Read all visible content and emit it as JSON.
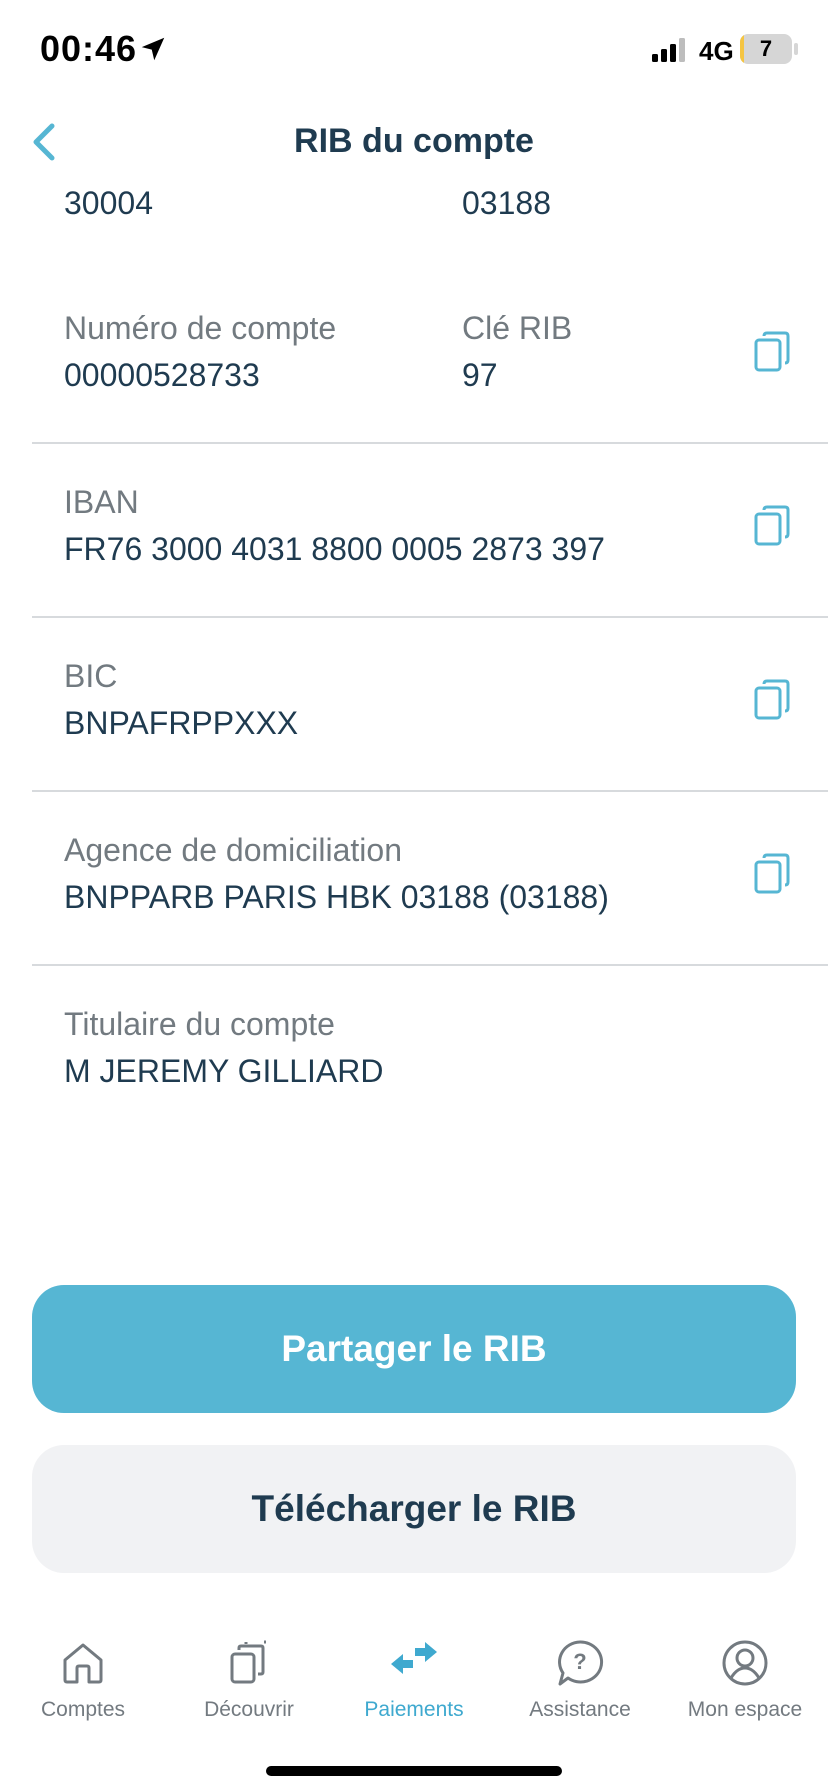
{
  "status_bar": {
    "time": "00:46",
    "network": "4G",
    "battery_level": "7",
    "battery_fraction": 0.07
  },
  "header": {
    "title": "RIB du compte",
    "back_icon": "chevron-left-icon"
  },
  "rib": {
    "bank_code_value": "30004",
    "branch_code_value": "03188",
    "account_number_label": "Numéro de compte",
    "account_number_value": "00000528733",
    "rib_key_label": "Clé RIB",
    "rib_key_value": "97",
    "iban_label": "IBAN",
    "iban_value": "FR76 3000 4031 8800 0005 2873 397",
    "bic_label": "BIC",
    "bic_value": "BNPAFRPPXXX",
    "agency_label": "Agence de domiciliation",
    "agency_value": "BNPPARB PARIS HBK 03188 (03188)",
    "holder_label": "Titulaire du compte",
    "holder_value": "M JEREMY GILLIARD"
  },
  "actions": {
    "share_label": "Partager le RIB",
    "download_label": "Télécharger le RIB"
  },
  "tab_bar": {
    "tabs": [
      {
        "label": "Comptes",
        "icon": "home-icon"
      },
      {
        "label": "Découvrir",
        "icon": "cards-icon"
      },
      {
        "label": "Paiements",
        "icon": "transfer-arrows-icon",
        "active": true
      },
      {
        "label": "Assistance",
        "icon": "help-bubble-icon"
      },
      {
        "label": "Mon espace",
        "icon": "user-circle-icon"
      }
    ]
  },
  "colors": {
    "accent": "#56b6d3",
    "text_primary": "#1f3b50",
    "text_secondary": "#727a80",
    "tab_active": "#3fa9cf"
  }
}
